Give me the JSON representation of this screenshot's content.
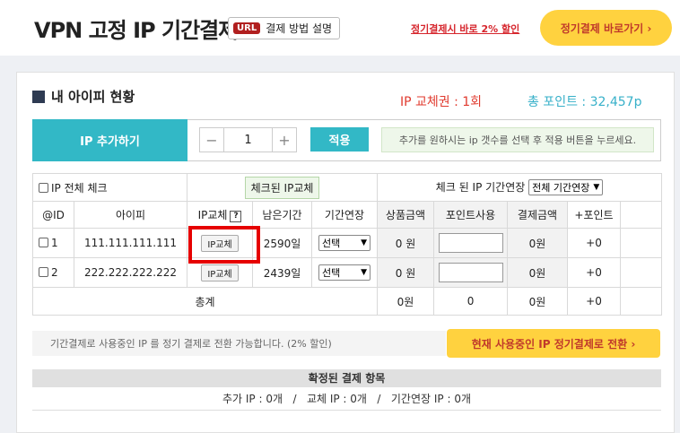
{
  "header": {
    "title": "VPN 고정 IP 기간결제",
    "url_badge": "URL",
    "help_label": "결제 방법 설명",
    "promo_link": "정기결제시 바로 2% 할인",
    "subscribe_button": "정기결제 바로가기 ›"
  },
  "status": {
    "section_title": "내 아이피 현황",
    "ticket_label": "IP 교체권 : 1회",
    "points_label": "총 포인트 : 32,457p"
  },
  "add_ip": {
    "label": "IP 추가하기",
    "minus": "−",
    "quantity": "1",
    "plus": "+",
    "apply_button": "적용",
    "hint": "추가를 원하시는 ip 갯수를 선택 후 적용 버튼을 누르세요."
  },
  "table": {
    "check_all_label": "IP 전체 체크",
    "swap_checked_button": "체크된 IP교체",
    "extend_checked_label": "체크 된 IP 기간연장",
    "extend_all_select": "전체 기간연장",
    "headers": {
      "id": "@ID",
      "ip": "아이피",
      "swap": "IP교체",
      "swap_help": "?",
      "remaining": "남은기간",
      "extend": "기간연장",
      "product_amount": "상품금액",
      "point_use": "포인트사용",
      "pay_amount": "결제금액",
      "plus_point": "+포인트"
    },
    "rows": [
      {
        "id": "1",
        "ip": "111.111.111.111",
        "swap_button": "IP교체",
        "remaining": "2590일",
        "extend": "선택",
        "product_amount": "0 원",
        "point_value": "",
        "pay_amount": "0원",
        "plus_point": "+0"
      },
      {
        "id": "2",
        "ip": "222.222.222.222",
        "swap_button": "IP교체",
        "remaining": "2439일",
        "extend": "선택",
        "product_amount": "0 원",
        "point_value": "",
        "pay_amount": "0원",
        "plus_point": "+0"
      }
    ],
    "total": {
      "label": "총계",
      "product_amount": "0원",
      "point_use": "0",
      "pay_amount": "0원",
      "plus_point": "+0"
    }
  },
  "convert": {
    "notice": "기간결제로 사용중인 IP 를 정기 결제로 전환 가능합니다. (2% 할인)",
    "button": "현재 사용중인 IP 정기결제로 전환 ›"
  },
  "summary": {
    "title": "확정된 결제 항목",
    "details": "추가 IP : 0개   /   교체 IP : 0개   /   기간연장 IP : 0개"
  },
  "colors": {
    "teal": "#32b8c6",
    "yellow": "#ffd23f",
    "red": "#e03a2e",
    "highlight": "#e60000"
  }
}
